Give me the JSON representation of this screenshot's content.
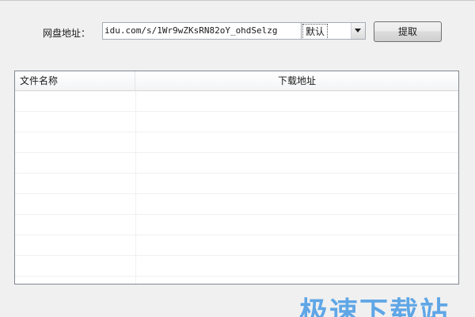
{
  "toolbar": {
    "url_label": "网盘地址：",
    "url_value": "idu.com/s/1Wr9wZKsRN82oY_ohdSelzg",
    "mode_select": {
      "selected": "默认"
    },
    "fetch_label": "提取"
  },
  "file_list": {
    "columns": [
      "文件名称",
      "下载地址"
    ],
    "rows": []
  },
  "watermark": "极速下载站"
}
